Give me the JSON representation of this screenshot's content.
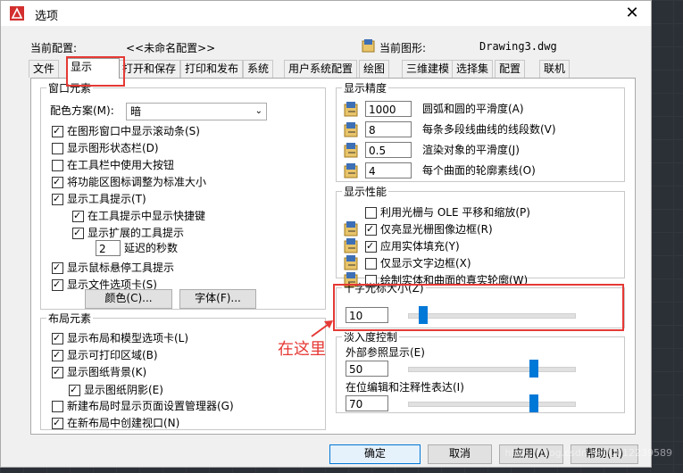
{
  "window": {
    "title": "选项",
    "close_glyph": "✕"
  },
  "info": {
    "current_profile_label": "当前配置:",
    "current_profile_value": "<<未命名配置>>",
    "current_drawing_label": "当前图形:",
    "current_drawing_value": "Drawing3.dwg"
  },
  "tabs": [
    "文件",
    "显示",
    "打开和保存",
    "打印和发布",
    "系统",
    "用户系统配置",
    "绘图",
    "三维建模",
    "选择集",
    "配置",
    "联机"
  ],
  "active_tab": "显示",
  "window_elements": {
    "legend": "窗口元素",
    "color_scheme_label": "配色方案(M):",
    "color_scheme_value": "暗",
    "checks": [
      {
        "label": "在图形窗口中显示滚动条(S)",
        "checked": true
      },
      {
        "label": "显示图形状态栏(D)",
        "checked": false
      },
      {
        "label": "在工具栏中使用大按钮",
        "checked": false
      },
      {
        "label": "将功能区图标调整为标准大小",
        "checked": true
      },
      {
        "label": "显示工具提示(T)",
        "checked": true
      },
      {
        "label": "在工具提示中显示快捷键",
        "checked": true
      },
      {
        "label": "显示扩展的工具提示",
        "checked": true
      },
      {
        "label": "显示鼠标悬停工具提示",
        "checked": true
      },
      {
        "label": "显示文件选项卡(S)",
        "checked": true
      }
    ],
    "delay_value": "2",
    "delay_label": "延迟的秒数",
    "colors_button": "颜色(C)...",
    "fonts_button": "字体(F)..."
  },
  "layout_elements": {
    "legend": "布局元素",
    "checks": [
      {
        "label": "显示布局和模型选项卡(L)",
        "checked": true
      },
      {
        "label": "显示可打印区域(B)",
        "checked": true
      },
      {
        "label": "显示图纸背景(K)",
        "checked": true
      },
      {
        "label": "显示图纸阴影(E)",
        "checked": true
      },
      {
        "label": "新建布局时显示页面设置管理器(G)",
        "checked": false
      },
      {
        "label": "在新布局中创建视口(N)",
        "checked": true
      }
    ]
  },
  "display_resolution": {
    "legend": "显示精度",
    "items": [
      {
        "value": "1000",
        "label": "圆弧和圆的平滑度(A)"
      },
      {
        "value": "8",
        "label": "每条多段线曲线的线段数(V)"
      },
      {
        "value": "0.5",
        "label": "渲染对象的平滑度(J)"
      },
      {
        "value": "4",
        "label": "每个曲面的轮廓素线(O)"
      }
    ]
  },
  "display_performance": {
    "legend": "显示性能",
    "checks": [
      {
        "label": "利用光栅与 OLE 平移和缩放(P)",
        "checked": false
      },
      {
        "label": "仅亮显光栅图像边框(R)",
        "checked": true
      },
      {
        "label": "应用实体填充(Y)",
        "checked": true
      },
      {
        "label": "仅显示文字边框(X)",
        "checked": false
      },
      {
        "label": "绘制实体和曲面的真实轮廓(W)",
        "checked": false
      }
    ]
  },
  "crosshair": {
    "legend": "十字光标大小(Z)",
    "value": "10",
    "level": 0.07
  },
  "fade": {
    "legend": "淡入度控制",
    "xref_label": "外部参照显示(E)",
    "xref_value": "50",
    "xref_level": 0.77,
    "inplace_label": "在位编辑和注释性表达(I)",
    "inplace_value": "70",
    "inplace_level": 0.77
  },
  "footer": {
    "ok": "确定",
    "cancel": "取消",
    "apply": "应用(A)",
    "help": "帮助(H)"
  },
  "annotation": {
    "text": "在这里"
  },
  "watermark": "https://blog.csdn.net/u012239589"
}
